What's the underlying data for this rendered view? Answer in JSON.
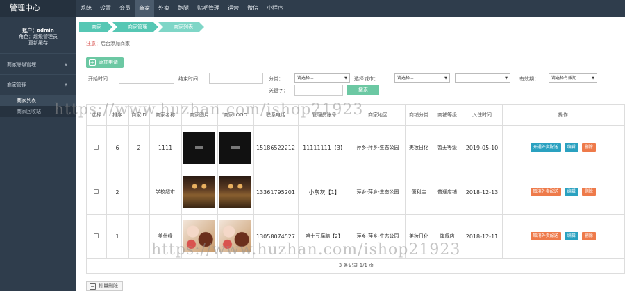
{
  "app": {
    "title": "管理中心"
  },
  "account": {
    "user_line": "账户：admin",
    "role_line": "角色：超级管理员",
    "cache_link": "更新缓存"
  },
  "sidebar": {
    "groups": [
      {
        "label": "商家等级管理",
        "chevron": "∨"
      },
      {
        "label": "商家管理",
        "chevron": "∧"
      }
    ],
    "items": [
      {
        "label": "商家列表"
      },
      {
        "label": "商家回收站"
      }
    ]
  },
  "topnav": [
    "系统",
    "设置",
    "会员",
    "商家",
    "外卖",
    "跑腿",
    "贴吧管理",
    "运营",
    "微信",
    "小程序"
  ],
  "breadcrumb": [
    "商家",
    "商家管理",
    "商家列表"
  ],
  "notice": {
    "label": "注意：",
    "text": "后台添加商家"
  },
  "toolbar": {
    "add_label": "添加申请",
    "bulk_delete_label": "批量删除"
  },
  "filters": {
    "start_time_label": "开始时间",
    "end_time_label": "结束时间",
    "category_label": "分类：",
    "category_value": "请选择...",
    "city_label": "选择城市：",
    "city_value": "请选择...",
    "city2_value": "",
    "valid_label": "有效期：",
    "valid_value": "请选择有效期",
    "keyword_label": "关键字：",
    "search_label": "搜索"
  },
  "table": {
    "headers": [
      "选择",
      "排序",
      "商家ID",
      "商家名称",
      "商家图片",
      "商家LOGO",
      "联系电话",
      "管理员账号",
      "商家地区",
      "商铺分类",
      "商铺等级",
      "入住时间",
      "操作"
    ],
    "rows": [
      {
        "sort": "6",
        "id": "2",
        "name": "1111",
        "phone": "15186522212",
        "admin": "11111111【3】",
        "region": "萍乡-萍乡-生态公园",
        "category": "美妆日化",
        "level": "暂无等级",
        "date": "2019-05-10",
        "img": "black",
        "logo": "black",
        "op1": "开通外卖配送",
        "op2": "编辑",
        "op3": "删除"
      },
      {
        "sort": "2",
        "id": "",
        "name": "学校超市",
        "phone": "13361795201",
        "admin": "小灰灰【1】",
        "region": "萍乡-萍乡-生态公园",
        "category": "便利店",
        "level": "普通店铺",
        "date": "2018-12-13",
        "img": "shop",
        "logo": "shop",
        "op1": "取消外卖配送",
        "op2": "编辑",
        "op3": "删除"
      },
      {
        "sort": "1",
        "id": "",
        "name": "美仕缘",
        "phone": "13058074527",
        "admin": "哈士豆腐脑【2】",
        "region": "萍乡-萍乡-生态公园",
        "category": "美妆日化",
        "level": "旗舰店",
        "date": "2018-12-11",
        "img": "cake",
        "logo": "cake",
        "op1": "取消外卖配送",
        "op2": "编辑",
        "op3": "删除"
      }
    ]
  },
  "pager": {
    "text": "3 条记录 1/1 页"
  },
  "watermark": "https://www.huzhan.com/ishop21923"
}
